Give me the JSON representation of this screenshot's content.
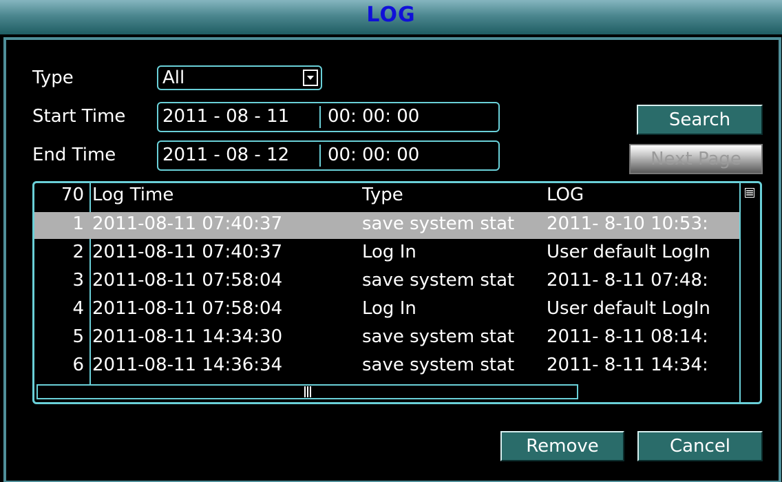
{
  "window": {
    "title": "LOG"
  },
  "filters": {
    "type_label": "Type",
    "type_value": "All",
    "start_label": "Start Time",
    "start_date": "2011 - 08 - 11",
    "start_time": "00: 00: 00",
    "end_label": "End Time",
    "end_date": "2011 - 08 - 12",
    "end_time": "00: 00: 00"
  },
  "buttons": {
    "search": "Search",
    "next_page": "Next Page",
    "remove": "Remove",
    "cancel": "Cancel"
  },
  "table": {
    "headers": {
      "count": "70",
      "time": "Log Time",
      "type": "Type",
      "log": "LOG"
    },
    "rows": [
      {
        "idx": "1",
        "time": "2011-08-11 07:40:37",
        "type": "save system stat",
        "log": "2011- 8-10 10:53:"
      },
      {
        "idx": "2",
        "time": "2011-08-11 07:40:37",
        "type": "Log In",
        "log": "User default LogIn"
      },
      {
        "idx": "3",
        "time": "2011-08-11 07:58:04",
        "type": "save system stat",
        "log": "2011- 8-11 07:48:"
      },
      {
        "idx": "4",
        "time": "2011-08-11 07:58:04",
        "type": "Log In",
        "log": "User default LogIn"
      },
      {
        "idx": "5",
        "time": "2011-08-11 14:34:30",
        "type": "save system stat",
        "log": "2011- 8-11 08:14:"
      },
      {
        "idx": "6",
        "time": "2011-08-11 14:36:34",
        "type": "save system stat",
        "log": "2011- 8-11 14:34:"
      }
    ],
    "selected_row": 1
  },
  "icons": {
    "dropdown": "chevron-down-icon",
    "vscroll_grip": "grip-lines-icon",
    "hscroll_grip": "grip-vertical-icon"
  },
  "colors": {
    "title_text": "#1010d8",
    "frame": "#4f8f99",
    "control_border": "#6ad0d8",
    "button": "#2a6c6a",
    "selected_row": "#b0b0b0"
  }
}
